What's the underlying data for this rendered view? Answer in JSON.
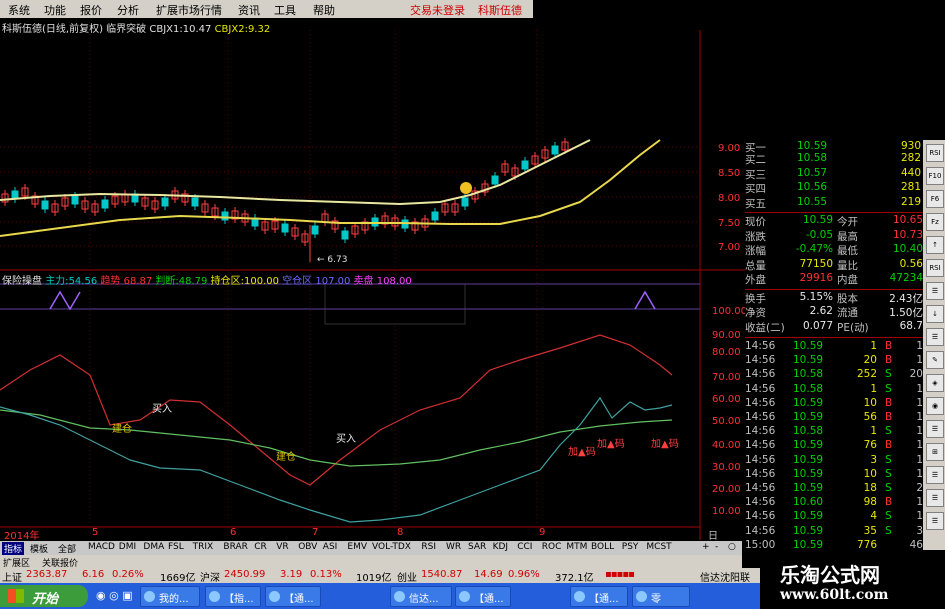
{
  "menu": {
    "items": [
      "系统",
      "功能",
      "报价",
      "分析",
      "扩展市场行情",
      "资讯",
      "工具",
      "帮助"
    ],
    "trade_status": "交易未登录",
    "stock_title": "科斯伍德"
  },
  "price_panel": {
    "stock_label": "科斯伍德(日线,前复权)",
    "indicator": "临界突破",
    "cbjx1_label": "CBJX1:",
    "cbjx1": "10.47",
    "cbjx2_label": "CBJX2:",
    "cbjx2": "9.32",
    "axis": [
      "9.00",
      "8.50",
      "8.00",
      "7.50",
      "7.00"
    ],
    "low_marker": "6.73"
  },
  "sub_indicator": {
    "name": "保险操盘",
    "items": [
      {
        "label": "主力:",
        "value": "54.56"
      },
      {
        "label": "趋势",
        "value": "68.87"
      },
      {
        "label": "判断:",
        "value": "48.79"
      },
      {
        "label": "持仓区:",
        "value": "100.00"
      },
      {
        "label": "空仓区",
        "value": "107.00"
      },
      {
        "label": "卖盘",
        "value": "108.00"
      }
    ],
    "axis": [
      "100.00",
      "90.00",
      "80.00",
      "70.00",
      "60.00",
      "50.00",
      "40.00",
      "30.00",
      "20.00",
      "10.00"
    ],
    "annotations": [
      "建仓",
      "买入",
      "建仓",
      "买入",
      "加▲码",
      "加▲码",
      "加▲码"
    ]
  },
  "dates": {
    "year": "2014年",
    "months": [
      "5",
      "6",
      "7",
      "8",
      "9"
    ],
    "period": "日线"
  },
  "quote": {
    "bids": [
      {
        "label": "买二",
        "price": "10.58",
        "vol": "282"
      },
      {
        "label": "买三",
        "price": "10.57",
        "vol": "440"
      },
      {
        "label": "买四",
        "price": "10.56",
        "vol": "281"
      },
      {
        "label": "买五",
        "price": "10.55",
        "vol": "219"
      }
    ],
    "bid1_partial": {
      "label": "买一",
      "price": "10.59",
      "vol": "930"
    },
    "stats": [
      {
        "l1": "现价",
        "v1": "10.59",
        "l2": "今开",
        "v2": "10.65"
      },
      {
        "l1": "涨跌",
        "v1": "-0.05",
        "l2": "最高",
        "v2": "10.73"
      },
      {
        "l1": "涨幅",
        "v1": "-0.47%",
        "l2": "最低",
        "v2": "10.40"
      },
      {
        "l1": "总量",
        "v1": "77150",
        "l2": "量比",
        "v2": "0.56"
      },
      {
        "l1": "外盘",
        "v1": "29916",
        "l2": "内盘",
        "v2": "47234"
      }
    ],
    "stats2": [
      {
        "l1": "换手",
        "v1": "5.15%",
        "l2": "股本",
        "v2": "2.43亿"
      },
      {
        "l1": "净资",
        "v1": "2.62",
        "l2": "流通",
        "v2": "1.50亿"
      },
      {
        "l1": "收益(二)",
        "v1": "0.077",
        "l2": "PE(动)",
        "v2": "68.7"
      }
    ],
    "ticks": [
      {
        "t": "14:56",
        "p": "10.59",
        "v": "1",
        "s": "B",
        "n": "1"
      },
      {
        "t": "14:56",
        "p": "10.59",
        "v": "20",
        "s": "B",
        "n": "1"
      },
      {
        "t": "14:56",
        "p": "10.58",
        "v": "252",
        "s": "S",
        "n": "20"
      },
      {
        "t": "14:56",
        "p": "10.58",
        "v": "1",
        "s": "S",
        "n": "1"
      },
      {
        "t": "14:56",
        "p": "10.59",
        "v": "10",
        "s": "B",
        "n": "1"
      },
      {
        "t": "14:56",
        "p": "10.59",
        "v": "56",
        "s": "B",
        "n": "1"
      },
      {
        "t": "14:56",
        "p": "10.58",
        "v": "1",
        "s": "S",
        "n": "1"
      },
      {
        "t": "14:56",
        "p": "10.59",
        "v": "76",
        "s": "B",
        "n": "1"
      },
      {
        "t": "14:56",
        "p": "10.59",
        "v": "3",
        "s": "S",
        "n": "1"
      },
      {
        "t": "14:56",
        "p": "10.59",
        "v": "10",
        "s": "S",
        "n": "1"
      },
      {
        "t": "14:56",
        "p": "10.59",
        "v": "18",
        "s": "S",
        "n": "2"
      },
      {
        "t": "14:56",
        "p": "10.60",
        "v": "98",
        "s": "B",
        "n": "1"
      },
      {
        "t": "14:56",
        "p": "10.59",
        "v": "4",
        "s": "S",
        "n": "1"
      },
      {
        "t": "14:56",
        "p": "10.59",
        "v": "35",
        "s": "S",
        "n": "3"
      },
      {
        "t": "15:00",
        "p": "10.59",
        "v": "776",
        "s": "",
        "n": "46"
      }
    ]
  },
  "side_buttons": [
    "RSI",
    "F10",
    "F6",
    "Fz",
    "↑",
    "RSI",
    "☰",
    "↓",
    "☰",
    "✎",
    "◈",
    "◉",
    "☰",
    "⊞",
    "☰",
    "☰",
    "☰"
  ],
  "indicator_tabs": {
    "left": [
      "指标",
      "模板",
      "全部"
    ],
    "items": [
      "MACD",
      "DMI",
      "DMA",
      "FSL",
      "TRIX",
      "BRAR",
      "CR",
      "VR",
      "OBV",
      "ASI",
      "EMV",
      "VOL-TDX",
      "RSI",
      "WR",
      "SAR",
      "KDJ",
      "CCI",
      "ROC",
      "MTM",
      "BOLL",
      "PSY",
      "MCST"
    ],
    "right": [
      "+",
      "-",
      "○"
    ]
  },
  "sub_tabs": [
    "扩展区",
    "关联报价"
  ],
  "status_bar": {
    "sh_label": "上证",
    "sh": "2363.87",
    "sh_chg": "6.16",
    "sh_pct": "0.26%",
    "sh_amt": "1669亿",
    "hs_label": "沪深",
    "hs": "2450.99",
    "hs_chg": "3.19",
    "hs_pct": "0.13%",
    "hs_amt": "1019亿",
    "cy_label": "创业",
    "cy": "1540.87",
    "cy_chg": "14.69",
    "cy_pct": "0.96%",
    "cy_amt": "372.1亿",
    "server": "信达沈阳联"
  },
  "taskbar": {
    "start": "开始",
    "buttons": [
      "我的...",
      "【指...",
      "【通...",
      "信达...",
      "【通...",
      "【通...",
      "零"
    ]
  },
  "watermark": {
    "line1": "乐淘公式网",
    "line2": "www.60lt.com"
  }
}
